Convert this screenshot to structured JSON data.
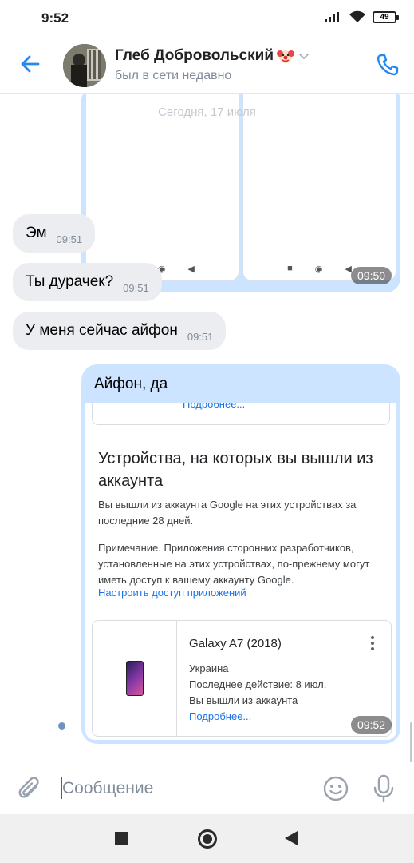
{
  "status_bar": {
    "time": "9:52",
    "battery": "49",
    "icons": [
      "signal-icon",
      "wifi-icon",
      "battery-icon"
    ]
  },
  "header": {
    "contact_name": "Глеб Добровольский",
    "status": "был в сети недавно",
    "icons": [
      "back-arrow-icon",
      "clown-emoji-icon",
      "chevron-down-icon",
      "phone-icon"
    ]
  },
  "chat": {
    "date_overlay": "Сегодня, 17 июля",
    "screenshot_message": {
      "time": "09:50"
    },
    "incoming": [
      {
        "text": "Эм",
        "time": "09:51"
      },
      {
        "text": "Ты дурачек?",
        "time": "09:51"
      },
      {
        "text": "У меня сейчас айфон",
        "time": "09:51"
      }
    ],
    "outgoing": {
      "text": "Айфон, да",
      "time": "09:52",
      "google_screenshot": {
        "prev_link": "Подробнее...",
        "title": "Устройства, на которых вы вышли из аккаунта",
        "paragraph1": "Вы вышли из аккаунта Google на этих устройствах за последние 28 дней.",
        "paragraph2": "Примечание. Приложения сторонних разработчиков, установленные на этих устройствах, по-прежнему могут иметь доступ к вашему аккаунту Google.",
        "access_link": "Настроить доступ приложений",
        "device": {
          "name": "Galaxy A7 (2018)",
          "country": "Украина",
          "last_action": "Последнее действие: 8 июл.",
          "state": "Вы вышли из аккаунта",
          "more_link": "Подробнее..."
        }
      }
    }
  },
  "composer": {
    "placeholder": "Сообщение",
    "icons": [
      "paperclip-icon",
      "emoji-icon",
      "microphone-icon"
    ]
  },
  "colors": {
    "accent": "#2688eb",
    "outgoing_bubble": "#cce4ff",
    "incoming_bubble": "#ebedf0",
    "link": "#1a73e8"
  }
}
